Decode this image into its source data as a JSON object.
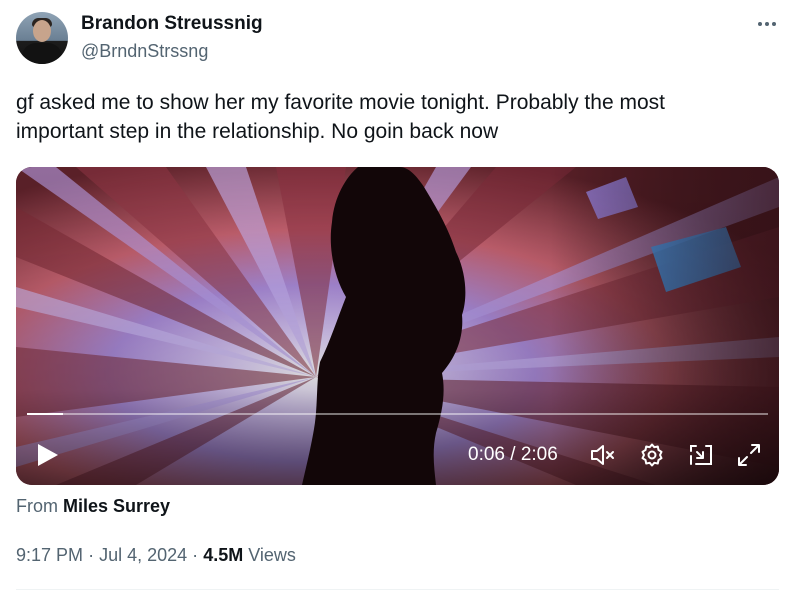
{
  "author": {
    "name": "Brandon Streussnig",
    "handle": "@BrndnStrssng"
  },
  "tweet": {
    "text_line1": "gf asked me to show her my favorite movie tonight. Probably the most",
    "text_line2": "important step in the relationship. No goin back now"
  },
  "video": {
    "time_display": "0:06 / 2:06",
    "progress_fraction": 0.048,
    "icons": [
      "play-icon",
      "mute-icon",
      "settings-gear-icon",
      "pop-out-icon",
      "fullscreen-icon"
    ]
  },
  "attribution": {
    "prefix": "From",
    "source": "Miles Surrey"
  },
  "meta": {
    "time": "9:17 PM",
    "separator": "·",
    "date": "Jul 4, 2024",
    "views_count": "4.5M",
    "views_label": "Views"
  },
  "colors": {
    "text_primary": "#0f1419",
    "text_secondary": "#536471",
    "background": "#ffffff"
  }
}
